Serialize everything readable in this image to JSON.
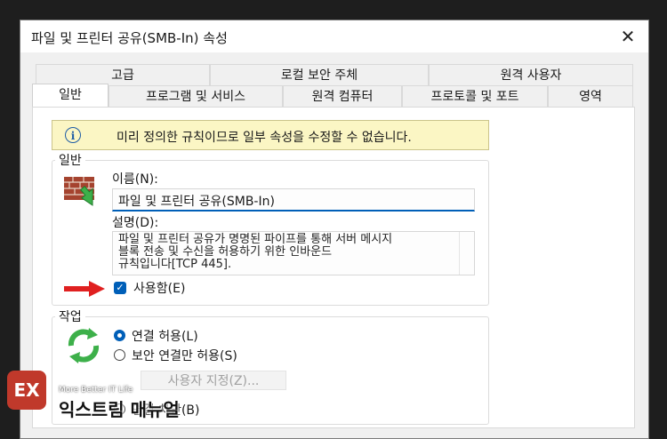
{
  "window": {
    "title": "파일 및 프린터 공유(SMB-In) 속성",
    "close_glyph": "✕"
  },
  "tabs_row1": [
    "고급",
    "로컬 보안 주체",
    "원격 사용자"
  ],
  "tabs_row2": [
    "일반",
    "프로그램 및 서비스",
    "원격 컴퓨터",
    "프로토콜 및 포트",
    "영역"
  ],
  "info": {
    "icon": "i",
    "text": "미리 정의한 규칙이므로 일부 속성을 수정할 수 없습니다."
  },
  "general": {
    "group_label": "일반",
    "name_label": "이름(N):",
    "name_value": "파일 및 프린터 공유(SMB-In)",
    "description_label": "설명(D):",
    "description_value": "파일 및 프린터 공유가 명명된 파이프를 통해 서버 메시지\n블록 전송 및 수신을 허용하기 위한 인바운드\n규칙입니다[TCP 445].",
    "enabled_label": "사용함(E)",
    "enabled_checked": true
  },
  "action": {
    "group_label": "작업",
    "options": [
      {
        "label": "연결 허용(L)",
        "selected": true
      },
      {
        "label": "보안 연결만 허용(S)",
        "selected": false
      },
      {
        "label": "연결 차단(B)",
        "selected": false
      }
    ],
    "customize_button": "사용자 지정(Z)..."
  },
  "watermark": {
    "small": "More Better IT Life",
    "big": "익스트림 매뉴얼",
    "logo": "EX"
  },
  "colors": {
    "accent": "#005fb8",
    "info_bg": "#fbf6c4",
    "arrow": "#e02020",
    "logo_red": "#c0392b"
  }
}
